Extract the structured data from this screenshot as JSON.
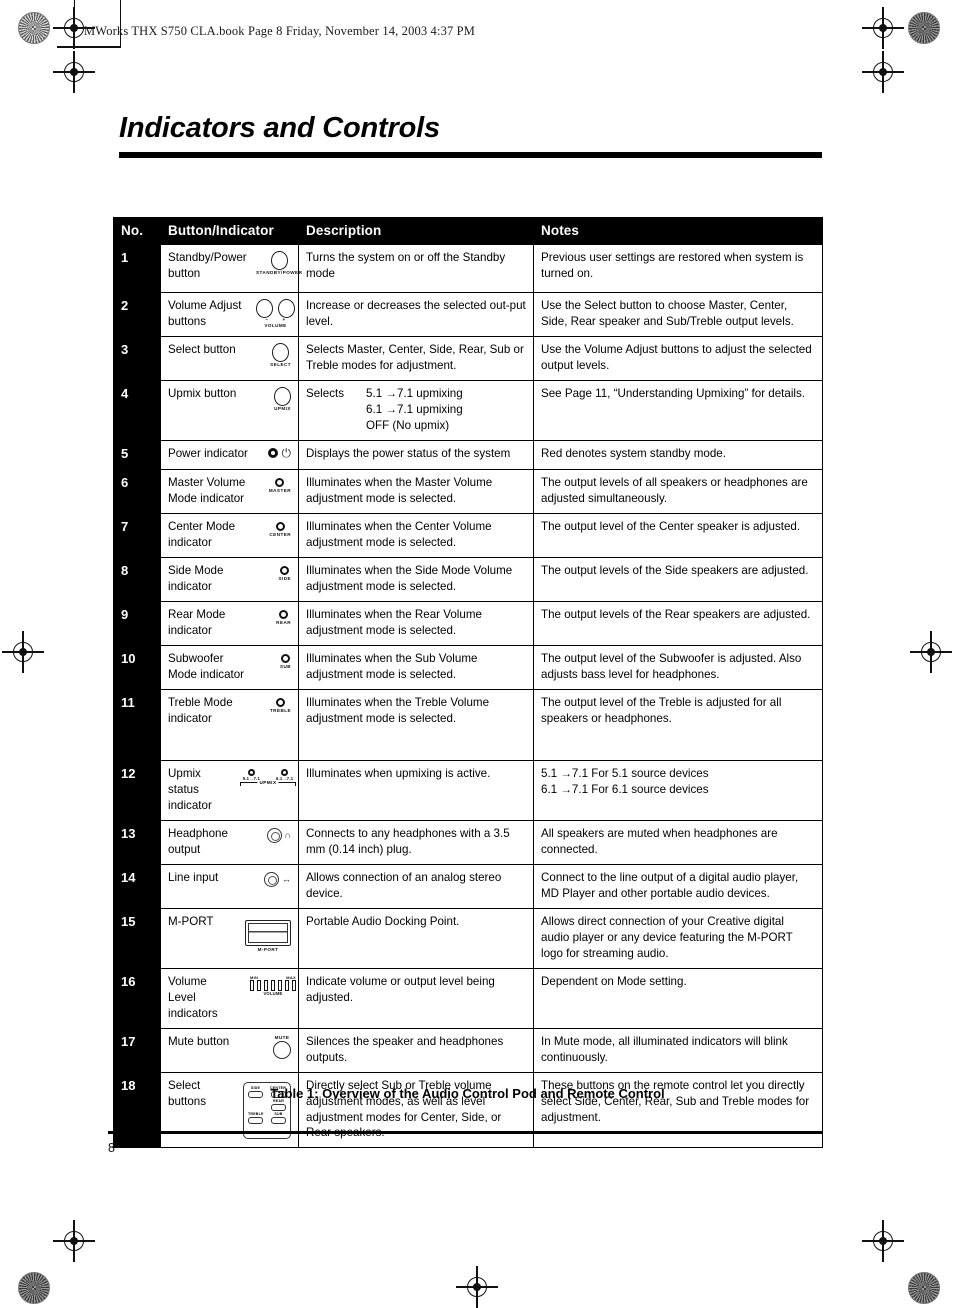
{
  "running_head": "MWorks THX S750 CLA.book  Page 8  Friday, November 14, 2003  4:37 PM",
  "title": "Indicators and Controls",
  "page_number": "8",
  "table": {
    "caption": "Table 1: Overview of the Audio Control Pod and Remote Control",
    "headers": {
      "no": "No.",
      "button": "Button/Indicator",
      "description": "Description",
      "notes": "Notes"
    },
    "rows": [
      {
        "no": "1",
        "button": "Standby/Power button",
        "icon": "standby-power-button",
        "icon_caption": "STANDBY/POWER",
        "description": "Turns the system on or off the Standby mode",
        "notes": "Previous user settings are restored when system is turned on."
      },
      {
        "no": "2",
        "button": "Volume Adjust buttons",
        "icon": "volume-adjust-buttons",
        "icon_caption": "VOLUME",
        "icon_minus": "–",
        "icon_plus": "+",
        "description": "Increase or decreases the selected out-put level.",
        "notes": "Use the Select button to choose Master, Center, Side, Rear speaker and Sub/Treble output levels."
      },
      {
        "no": "3",
        "button": "Select button",
        "icon": "select-button",
        "icon_caption": "SELECT",
        "description": "Selects Master, Center, Side, Rear, Sub or Treble modes for adjustment.",
        "notes": "Use the Volume Adjust buttons to adjust the selected output levels."
      },
      {
        "no": "4",
        "button": "Upmix button",
        "icon": "upmix-button",
        "icon_caption": "UPMIX",
        "description_lead": "Selects",
        "description_options": [
          "5.1 →7.1 upmixing",
          "6.1 →7.1 upmixing",
          "OFF (No upmix)"
        ],
        "notes": "See Page 11, “Understanding Upmixing” for details."
      },
      {
        "no": "5",
        "button": "Power indicator",
        "icon": "power-indicator-led",
        "icon_glyph": "⏻",
        "description": "Displays the power status of the system",
        "notes": "Red denotes system standby mode."
      },
      {
        "no": "6",
        "button": "Master Volume Mode indicator",
        "icon": "master-mode-led",
        "icon_caption": "MASTER",
        "description": "Illuminates when the Master Volume adjustment mode is selected.",
        "notes": "The output levels of all speakers or headphones are adjusted simultaneously."
      },
      {
        "no": "7",
        "button": "Center Mode indicator",
        "icon": "center-mode-led",
        "icon_caption": "CENTER",
        "description": "Illuminates when the Center Volume adjustment mode is selected.",
        "notes": "The output level of the Center speaker is adjusted."
      },
      {
        "no": "8",
        "button": "Side Mode indicator",
        "icon": "side-mode-led",
        "icon_caption": "SIDE",
        "description": "Illuminates when the Side Mode Volume adjustment mode is selected.",
        "notes": "The output levels of the Side speakers are adjusted."
      },
      {
        "no": "9",
        "button": "Rear Mode indicator",
        "icon": "rear-mode-led",
        "icon_caption": "REAR",
        "description": "Illuminates when the Rear Volume adjustment mode is selected.",
        "notes": "The output levels of the Rear speakers are adjusted."
      },
      {
        "no": "10",
        "button": "Subwoofer Mode indicator",
        "icon": "subwoofer-mode-led",
        "icon_caption": "SUB",
        "description": "Illuminates when the Sub Volume adjustment mode is selected.",
        "notes": "The output level of the Subwoofer is adjusted. Also adjusts bass level for headphones."
      },
      {
        "no": "11",
        "button": "Treble Mode indicator",
        "icon": "treble-mode-led",
        "icon_caption": "TREBLE",
        "description": "Illuminates when the Treble Volume adjustment mode is selected.",
        "notes": "The output level of the Treble is adjusted for all speakers or headphones."
      },
      {
        "no": "12",
        "button": "Upmix status indicator",
        "icon": "upmix-status-leds",
        "icon_caption_left": "5.1→7.1",
        "icon_caption_right": "6.1→7.1",
        "icon_caption": "UPMIX",
        "description": "Illuminates when upmixing is active.",
        "notes_lines": [
          "5.1 →7.1 For 5.1 source devices",
          "6.1 →7.1 For 6.1 source devices"
        ]
      },
      {
        "no": "13",
        "button": "Headphone output",
        "icon": "headphone-jack",
        "icon_glyph": "∩",
        "description": "Connects to any headphones with a 3.5 mm (0.14 inch) plug.",
        "notes": "All speakers are muted when headphones are connected."
      },
      {
        "no": "14",
        "button": "Line input",
        "icon": "line-input-jack",
        "icon_glyph": "↔",
        "description": "Allows connection of an analog stereo device.",
        "notes": "Connect to the line output of a digital audio player, MD Player and other portable audio devices."
      },
      {
        "no": "15",
        "button": "M-PORT",
        "icon": "m-port-connector",
        "icon_caption": "M-PORT",
        "description": "Portable Audio Docking Point.",
        "notes": "Allows direct connection of your Creative digital audio player or any device featuring the M-PORT logo for streaming audio."
      },
      {
        "no": "16",
        "button": "Volume Level indicators",
        "icon": "volume-level-bars",
        "icon_caption_left": "MIN",
        "icon_caption_right": "MAX",
        "icon_caption": "VOLUME",
        "bar_count": 7,
        "description": "Indicate volume or output level being adjusted.",
        "notes": "Dependent on Mode setting."
      },
      {
        "no": "17",
        "button": "Mute button",
        "icon": "mute-button",
        "icon_caption": "MUTE",
        "description": "Silences the speaker and headphones outputs.",
        "notes": "In Mute mode, all illuminated indicators will blink continuously."
      },
      {
        "no": "18",
        "button": "Select buttons",
        "icon": "remote-control-select-buttons",
        "remote_buttons": [
          "SIDE",
          "CENTER",
          "REAR",
          "TREBLE",
          "SUB"
        ],
        "description": "Directly select Sub or Treble volume adjustment modes, as well as level adjustment modes for Center, Side, or Rear speakers.",
        "notes": "These buttons on the remote control let you directly select Side, Center, Rear, Sub and Treble modes for adjustment."
      }
    ]
  }
}
